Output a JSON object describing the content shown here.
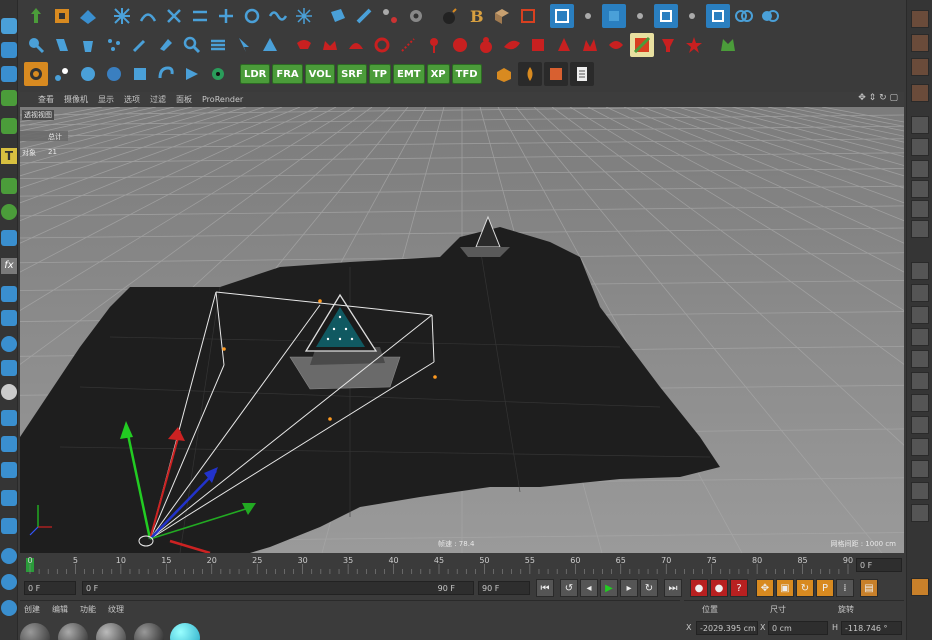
{
  "menu": {
    "items": [
      "查看",
      "摄像机",
      "显示",
      "选项",
      "过滤",
      "面板",
      "ProRender"
    ]
  },
  "viewport": {
    "title": "透视视图",
    "stats_header": "总计",
    "stats_label": "对象",
    "stats_value": "21",
    "fps_label": "帧速 : 78.4",
    "grid_label": "网格间距 : 1000 cm"
  },
  "toolbar3": {
    "tags": [
      "LDR",
      "FRA",
      "VOL",
      "SRF",
      "TP",
      "EMT",
      "XP",
      "TFD"
    ]
  },
  "timeline": {
    "ticks": [
      "0",
      "5",
      "10",
      "15",
      "20",
      "25",
      "30",
      "35",
      "40",
      "45",
      "50",
      "55",
      "60",
      "65",
      "70",
      "75",
      "80",
      "85",
      "90"
    ],
    "current_frame_right": "0 F"
  },
  "transport": {
    "start_field": "0 F",
    "range_start": "0 F",
    "range_end": "90 F",
    "end_field": "90 F"
  },
  "material_panel": {
    "tabs": [
      "创建",
      "编辑",
      "功能",
      "纹理"
    ]
  },
  "coord_panel": {
    "headers": [
      "位置",
      "尺寸",
      "旋转"
    ],
    "x_label": "X",
    "x_position": "-2029.395 cm",
    "x_label2": "X",
    "x_size": "0 cm",
    "h_label": "H",
    "h_rotation": "-118.746 °"
  },
  "colors": {
    "viewport_bg": "#8a8a8a",
    "terrain": "#1e1e1e",
    "tag_green": "#4b9c3a",
    "axis_green": "#22cc22",
    "axis_red": "#cc2222",
    "axis_blue": "#2233cc"
  }
}
